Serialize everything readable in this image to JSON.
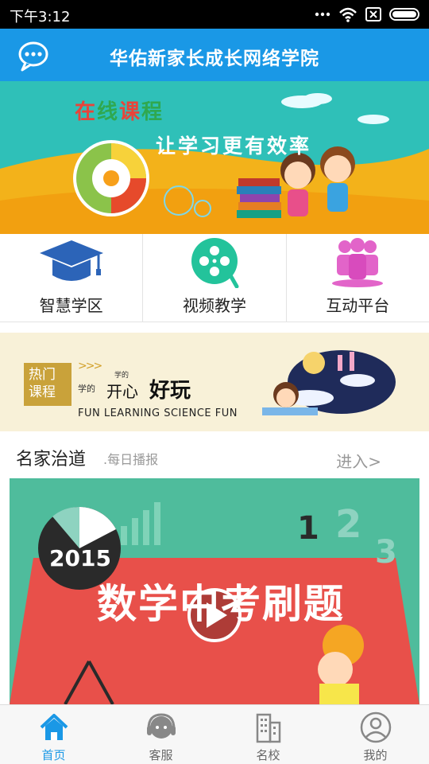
{
  "status_bar": {
    "time": "下午3:12"
  },
  "header": {
    "title": "华佑新家长成长网络学院"
  },
  "banner": {
    "line1": "在线课程",
    "line2": "让学习更有效率"
  },
  "quick_links": [
    {
      "label": "智慧学区",
      "icon": "graduation-cap-icon"
    },
    {
      "label": "视频教学",
      "icon": "film-reel-icon"
    },
    {
      "label": "互动平台",
      "icon": "people-group-icon"
    }
  ],
  "hot_course": {
    "tag": "热门课程",
    "arrows": ">>>",
    "small1": "学的",
    "small2": "学的",
    "kaixin": "开心",
    "haowan": "好玩",
    "english": "FUN LEARNING SCIENCE FUN"
  },
  "section": {
    "name": "名家治道",
    "subtitle": ".每日播报",
    "enter": "进入>"
  },
  "video": {
    "title": "数学中考刷题",
    "year": "2015",
    "digits": [
      "1",
      "2",
      "3"
    ]
  },
  "tab_bar": [
    {
      "label": "首页",
      "icon": "home-icon",
      "active": true
    },
    {
      "label": "客服",
      "icon": "headset-icon",
      "active": false
    },
    {
      "label": "名校",
      "icon": "building-icon",
      "active": false
    },
    {
      "label": "我的",
      "icon": "user-icon",
      "active": false
    }
  ],
  "colors": {
    "primary": "#1a98e6",
    "teal": "#23c39b",
    "pink": "#e264c9",
    "navy": "#2c64b8"
  }
}
